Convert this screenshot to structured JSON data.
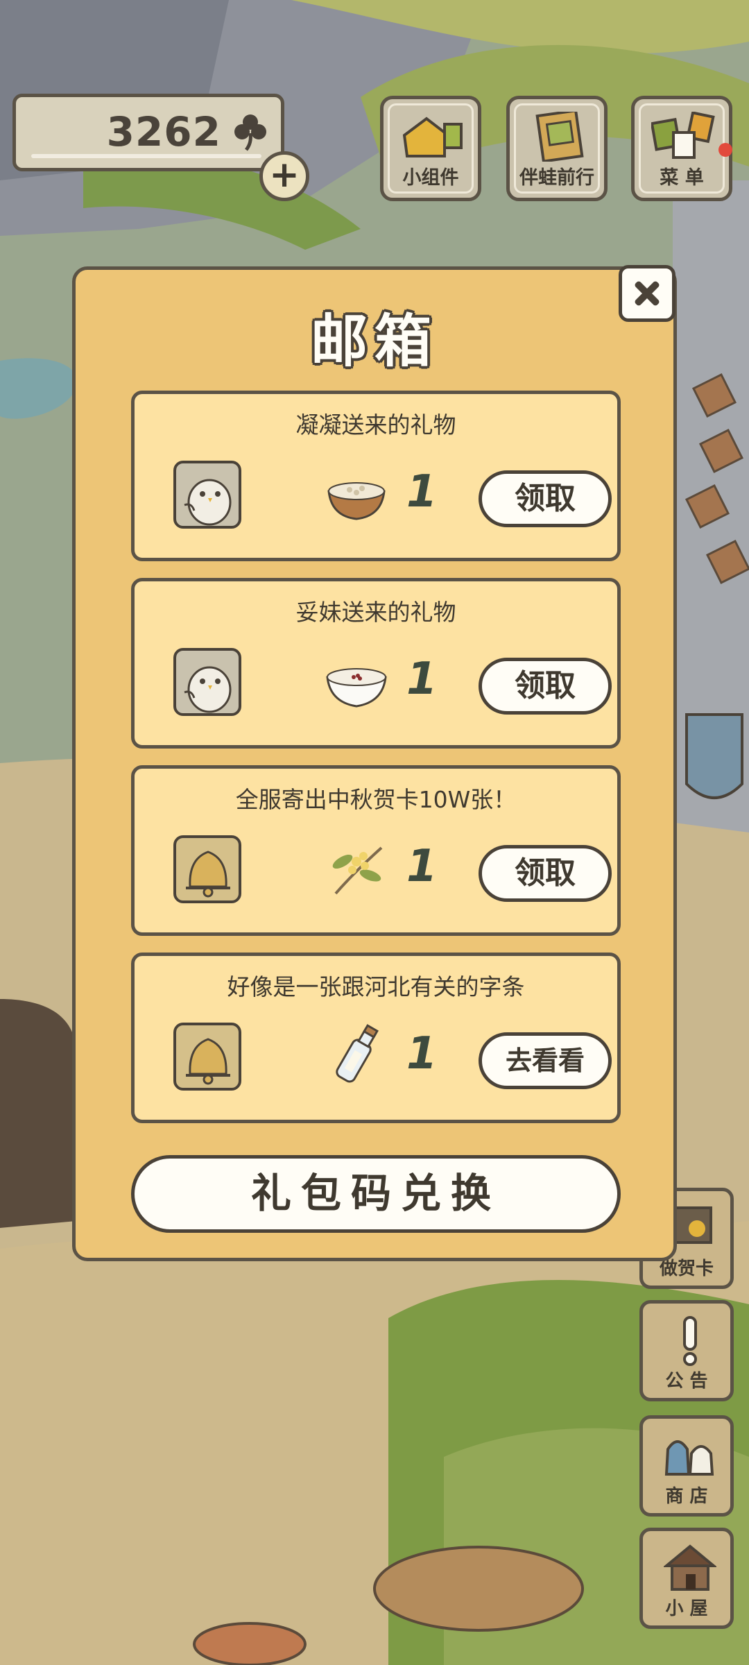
{
  "hud": {
    "clover_count": "3262",
    "plus_label": "+",
    "clover_icon": "clover-icon"
  },
  "top_menu": [
    {
      "label": "小组件",
      "icon": "widget-icon"
    },
    {
      "label": "伴蛙前行",
      "icon": "frog-photo-icon"
    },
    {
      "label": "菜 单",
      "icon": "menu-cards-icon"
    }
  ],
  "side_menu": [
    {
      "label": "做贺卡",
      "icon": "card-icon"
    },
    {
      "label": "公 告",
      "icon": "exclamation-icon"
    },
    {
      "label": "商 店",
      "icon": "shop-bags-icon"
    },
    {
      "label": "小 屋",
      "icon": "house-icon"
    }
  ],
  "mailbox": {
    "title": "邮箱",
    "close_icon": "close-icon",
    "mails": [
      {
        "title": "凝凝送来的礼物",
        "sender_icon": "bird-avatar-icon",
        "item_icon": "rice-bowl-icon",
        "qty": "1",
        "action": "领取"
      },
      {
        "title": "妥妹送来的礼物",
        "sender_icon": "bird-avatar-icon",
        "item_icon": "porridge-bowl-icon",
        "qty": "1",
        "action": "领取"
      },
      {
        "title": "全服寄出中秋贺卡10W张！",
        "sender_icon": "bell-icon",
        "item_icon": "osmanthus-icon",
        "qty": "1",
        "action": "领取"
      },
      {
        "title": "好像是一张跟河北有关的字条",
        "sender_icon": "bell-icon",
        "item_icon": "message-bottle-icon",
        "qty": "1",
        "action": "去看看"
      }
    ],
    "redeem_label": "礼包码兑换"
  },
  "colors": {
    "panel": "#edc576",
    "card": "#fde2a2",
    "outline": "#5b5346"
  }
}
